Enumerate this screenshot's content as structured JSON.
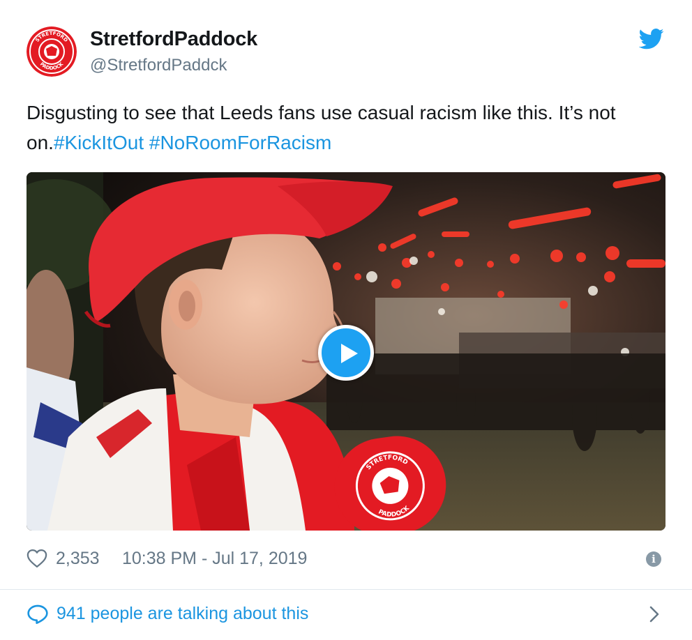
{
  "account": {
    "display_name": "StretfordPaddock",
    "handle": "@StretfordPaddck",
    "avatar_text_top": "STRETFORD",
    "avatar_text_bottom": "PADDOCK"
  },
  "tweet": {
    "text_plain": "Disgusting to see that Leeds fans use casual racism like this. It’s not on.",
    "hashtags": [
      "#KickItOut",
      "#NoRoomForRacism"
    ]
  },
  "media": {
    "type": "video",
    "mic_text_top": "STRETFORD",
    "mic_text_bottom": "PADDOCK"
  },
  "meta": {
    "likes": "2,353",
    "timestamp": "10:38 PM - Jul 17, 2019"
  },
  "footer": {
    "talking_text": "941 people are talking about this"
  },
  "colors": {
    "link": "#1b95e0",
    "twitter_blue": "#1da1f2",
    "text_primary": "#14171a",
    "text_secondary": "#657786",
    "brand_red": "#e31b23"
  },
  "icons": {
    "logo": "twitter-bird-icon",
    "like": "heart-outline-icon",
    "info": "info-icon",
    "reply": "speech-bubble-icon",
    "play": "play-icon",
    "chevron": "chevron-right-icon"
  }
}
